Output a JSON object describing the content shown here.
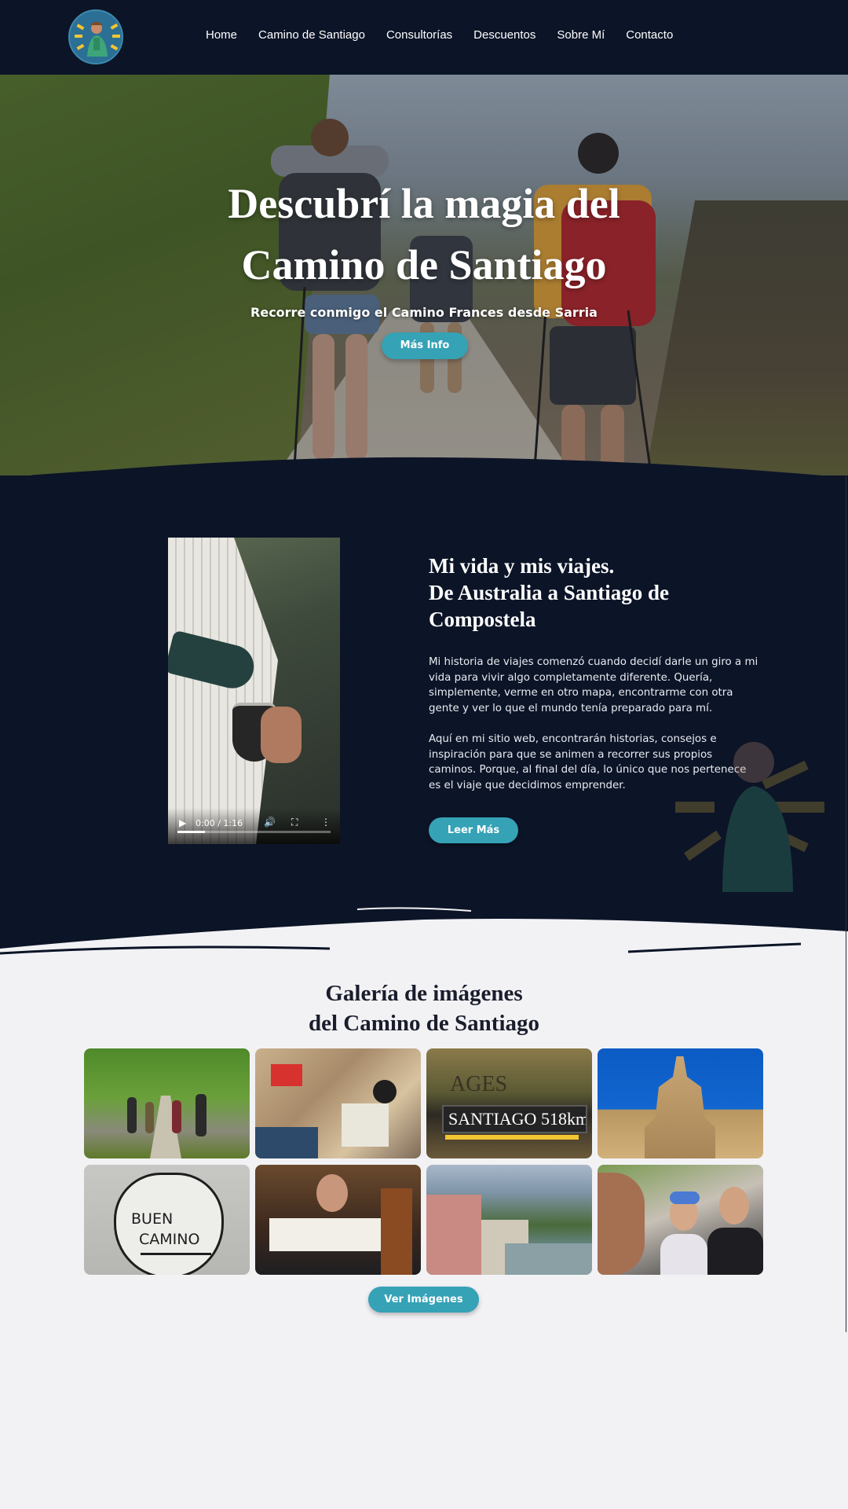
{
  "nav": {
    "links": [
      {
        "label": "Home"
      },
      {
        "label": "Camino de Santiago"
      },
      {
        "label": "Consultorías"
      },
      {
        "label": "Descuentos"
      },
      {
        "label": "Sobre Mí"
      },
      {
        "label": "Contacto"
      }
    ],
    "logo_icon": "hiker-logo-icon"
  },
  "hero": {
    "title_line1": "Descubrí la magia del",
    "title_line2": "Camino de Santiago",
    "subtitle": "Recorre conmigo el Camino Frances desde Sarria",
    "button_label": "Más Info"
  },
  "about": {
    "title_line1": "Mi vida y mis viajes.",
    "title_line2": "De Australia a Santiago de Compostela",
    "paragraph1": "Mi historia de viajes comenzó cuando decidí darle un giro a mi vida para vivir algo completamente diferente. Quería, simplemente, verme en otro mapa, encontrarme con otra gente y ver lo que el mundo tenía preparado para mí.",
    "paragraph2": "Aquí en mi sitio web, encontrarán historias,  consejos e inspiración para que se animen a recorrer sus propios caminos. Porque, al final del día, lo único que nos pertenece es el viaje que decidimos emprender.",
    "button_label": "Leer Más",
    "video": {
      "time": "0:00 / 1:16",
      "progress": 0.18
    }
  },
  "gallery": {
    "title_line1": "Galería de imágenes",
    "title_line2": "del Camino de Santiago",
    "tile_text": {
      "sign_top": "AGES",
      "sign_main": "SANTIAGO 518km.",
      "buen": "BUEN",
      "camino": "CAMINO"
    },
    "button_label": "Ver Imágenes"
  },
  "colors": {
    "navy": "#0c1427",
    "accent": "#35a2b6",
    "page_bg": "#f2f2f5"
  }
}
